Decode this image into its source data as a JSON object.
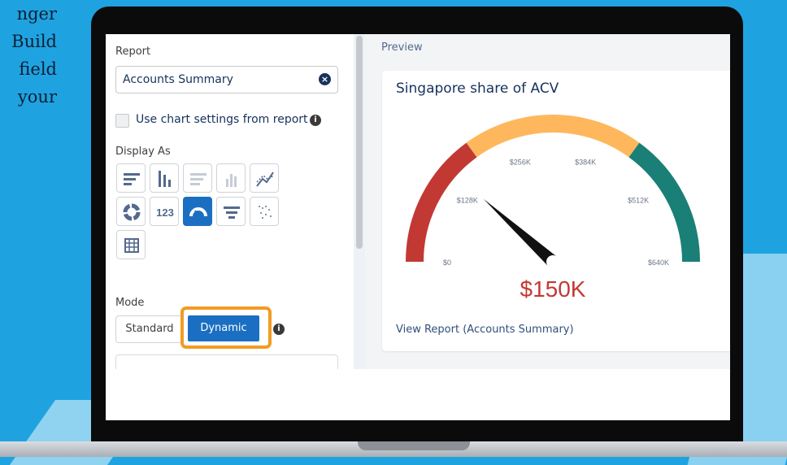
{
  "background_text": [
    "nger",
    "Build",
    "field",
    "your"
  ],
  "left_panel": {
    "report_label": "Report",
    "report_value": "Accounts Summary",
    "use_chart_settings_label": "Use chart settings from report",
    "display_as_label": "Display As",
    "display_types": [
      "horizontal-bar",
      "vertical-bar",
      "stacked-horizontal-bar",
      "stacked-vertical-bar",
      "line",
      "donut",
      "metric",
      "gauge",
      "funnel",
      "scatter",
      "table"
    ],
    "selected_display": "gauge",
    "metric_glyph": "123",
    "mode_label": "Mode",
    "mode_standard": "Standard",
    "mode_dynamic": "Dynamic",
    "selected_mode": "Dynamic"
  },
  "right_panel": {
    "preview_label": "Preview",
    "card_title": "Singapore share of ACV",
    "view_report_link": "View Report (Accounts Summary)"
  },
  "chart_data": {
    "type": "gauge",
    "title": "Singapore share of ACV",
    "value": 150,
    "value_label": "$150K",
    "min": 0,
    "max": 640,
    "ticks": [
      0,
      128,
      256,
      384,
      512,
      640
    ],
    "tick_labels": [
      "$0",
      "$128K",
      "$256K",
      "$384K",
      "$512K",
      "$640K"
    ],
    "bands": [
      {
        "from": 0,
        "to": 192,
        "color": "#c23934"
      },
      {
        "from": 192,
        "to": 448,
        "color": "#ffb75d"
      },
      {
        "from": 448,
        "to": 640,
        "color": "#1a7f77"
      }
    ],
    "value_color": "#c23934"
  },
  "colors": {
    "accent": "#1b6fc2",
    "highlight": "#f29c24"
  }
}
